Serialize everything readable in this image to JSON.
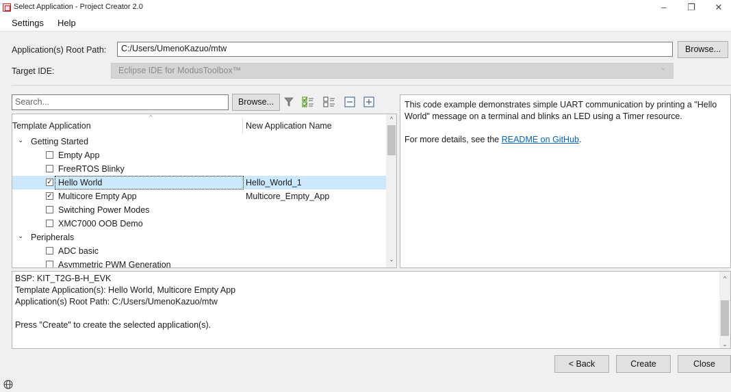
{
  "window": {
    "title": "Select Application - Project Creator 2.0",
    "minimize_glyph": "–",
    "maximize_glyph": "❐",
    "close_glyph": "✕"
  },
  "menu": {
    "settings": "Settings",
    "help": "Help"
  },
  "root_path": {
    "label": "Application(s) Root Path:",
    "value": "C:/Users/UmenoKazuo/mtw",
    "browse_label": "Browse..."
  },
  "target_ide": {
    "label": "Target IDE:",
    "value": "Eclipse IDE for ModusToolbox™",
    "arrow": "⌄"
  },
  "search": {
    "placeholder": "Search...",
    "browse_label": "Browse..."
  },
  "tree": {
    "col_template": "Template Application",
    "col_new_name": "New Application Name",
    "sort_caret": "^",
    "groups": [
      {
        "label": "Getting Started",
        "expanded": true,
        "items": [
          {
            "label": "Empty App",
            "checked": false,
            "new_name": ""
          },
          {
            "label": "FreeRTOS Blinky",
            "checked": false,
            "new_name": ""
          },
          {
            "label": "Hello World",
            "checked": true,
            "new_name": "Hello_World_1",
            "selected": true
          },
          {
            "label": "Multicore Empty App",
            "checked": true,
            "new_name": "Multicore_Empty_App"
          },
          {
            "label": "Switching Power Modes",
            "checked": false,
            "new_name": ""
          },
          {
            "label": "XMC7000 OOB Demo",
            "checked": false,
            "new_name": ""
          }
        ]
      },
      {
        "label": "Peripherals",
        "expanded": true,
        "items": [
          {
            "label": "ADC basic",
            "checked": false,
            "new_name": ""
          },
          {
            "label": "Asymmetric PWM Generation",
            "checked": false,
            "new_name": ""
          }
        ]
      }
    ],
    "scroll_up": "^",
    "scroll_down": "⌄"
  },
  "description": {
    "text": "This code example demonstrates simple UART communication by printing a \"Hello World\" message on a terminal and blinks an LED using a Timer resource.",
    "more_prefix": "For more details, see the ",
    "link_text": "README on GitHub",
    "more_suffix": "."
  },
  "summary": {
    "lines": [
      "BSP: KIT_T2G-B-H_EVK",
      "Template Application(s): Hello World, Multicore Empty App",
      "Application(s) Root Path: C:/Users/UmenoKazuo/mtw",
      "",
      "Press \"Create\" to create the selected application(s)."
    ],
    "scroll_up": "^",
    "scroll_down": "⌄"
  },
  "buttons": {
    "back": "< Back",
    "create": "Create",
    "close": "Close"
  },
  "icons": [
    "app-icon",
    "filter-icon",
    "check-all-icon",
    "uncheck-all-icon",
    "collapse-all-icon",
    "expand-all-icon",
    "globe-icon"
  ],
  "colors": {
    "selection": "#cce8ff",
    "link": "#0563c1",
    "icon_green": "#5aa02c"
  }
}
